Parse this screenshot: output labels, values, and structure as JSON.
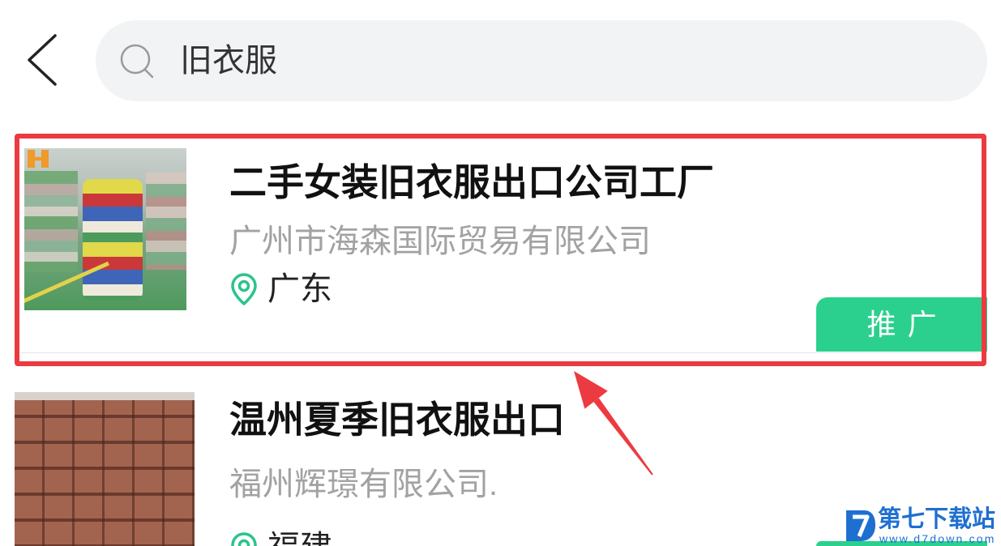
{
  "header": {
    "back_icon": "chevron-left-icon",
    "search": {
      "icon": "search-icon",
      "query": "旧衣服"
    }
  },
  "results": [
    {
      "title": "二手女装旧衣服出口公司工厂",
      "company": "广州市海森国际贸易有限公司",
      "location_icon": "location-pin-icon",
      "location": "广东",
      "badge": "推广",
      "highlighted": true
    },
    {
      "title": "温州夏季旧衣服出口",
      "company": "福州辉璟有限公司.",
      "location_icon": "location-pin-icon",
      "location": "福建"
    }
  ],
  "annotation": {
    "highlight_color": "#eb3b40",
    "arrow_color": "#eb3b40"
  },
  "watermark": {
    "name": "第七下载站",
    "url": "www.d7down.com"
  },
  "colors": {
    "accent_green": "#2bd08e",
    "search_bg": "#f2f3f5",
    "watermark_blue": "#1f6fd1"
  }
}
